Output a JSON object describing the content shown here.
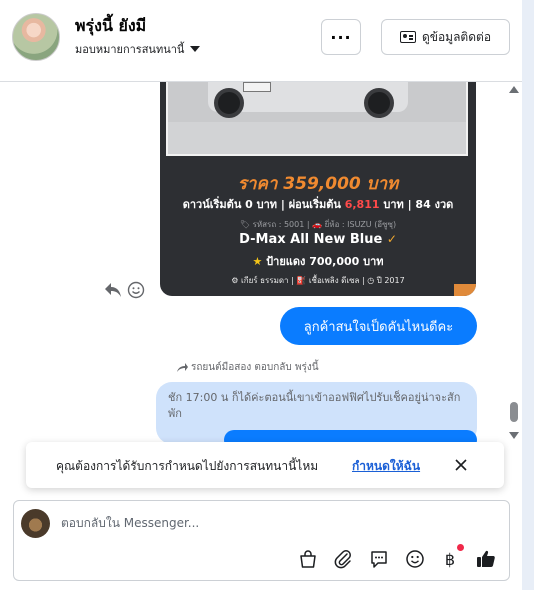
{
  "header": {
    "contact_name": "พรุ่งนี้ ยังมี",
    "assign_label": "มอบหมายการสนทนานี้",
    "more_label": "···",
    "contact_info_label": "ดูข้อมูลติดต่อ"
  },
  "car_ad": {
    "price": "ราคา 359,000 บาท",
    "down_prefix": "ดาวน์เริ่มต้น 0 บาท | ผ่อนเริ่มต้น ",
    "down_amount": "6,811",
    "down_suffix": " บาท | 84 งวด",
    "meta": "🏷 รหัสรถ : 5001 | 🚗 ยี่ห้อ : ISUZU (อีซูซุ)",
    "model": "D-Max All New Blue",
    "model_check": "✓",
    "plate_star": "★",
    "plate_text": " ป้ายแดง 700,000 บาท",
    "specs": "⚙ เกียร์ ธรรมดา   |   ⛽ เชื้อเพลิง ดีเซล   |   ◷ ปี 2017"
  },
  "messages": {
    "outgoing_1": "ลูกค้าสนใจเป็ดคันไหนดีคะ",
    "reply_note": "รถยนต์มือสอง ตอบกลับ พรุ่งนี้",
    "quoted_text": "ชัก 17:00 น ก็ได้ค่ะตอนนี้เขาเข้าออฟฟิศไปรับเช็คอยู่น่าจะสักพัก"
  },
  "banner": {
    "text": "คุณต้องการได้รับการกำหนดไปยังการสนทนานี้ไหม",
    "link": "กำหนดให้ฉัน"
  },
  "composer": {
    "placeholder": "ตอบกลับใน Messenger..."
  },
  "colors": {
    "accent": "#0a7cff",
    "link": "#1a5fd6",
    "ad_price": "#f08a30",
    "notification": "#f02849"
  }
}
